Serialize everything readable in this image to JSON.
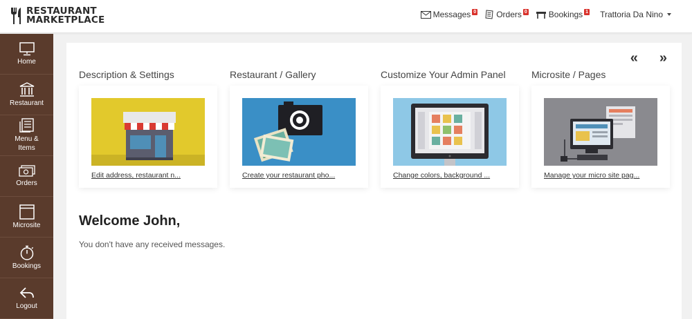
{
  "brand": {
    "line1": "RESTAURANT",
    "line2": "MARKETPLACE"
  },
  "header": {
    "messages": {
      "label": "Messages",
      "count": "0"
    },
    "orders": {
      "label": "Orders",
      "count": "0"
    },
    "bookings": {
      "label": "Bookings",
      "count": "1"
    },
    "user": "Trattoria Da Nino"
  },
  "sidebar": {
    "items": [
      {
        "label": "Home",
        "icon": "monitor-icon"
      },
      {
        "label": "Restaurant",
        "icon": "building-icon"
      },
      {
        "label": "Menu & Items",
        "icon": "menu-icon"
      },
      {
        "label": "Orders",
        "icon": "money-icon"
      },
      {
        "label": "Microsite",
        "icon": "window-icon"
      },
      {
        "label": "Bookings",
        "icon": "stopwatch-icon"
      },
      {
        "label": "Logout",
        "icon": "logout-icon"
      }
    ]
  },
  "carousel": {
    "prev": "«",
    "next": "»",
    "cards": [
      {
        "title": "Description & Settings",
        "link": "Edit address, restaurant n..."
      },
      {
        "title": "Restaurant / Gallery",
        "link": "Create your restaurant pho..."
      },
      {
        "title": "Customize Your Admin Panel",
        "link": "Change colors, background ..."
      },
      {
        "title": "Microsite / Pages",
        "link": "Manage your micro site pag..."
      }
    ]
  },
  "welcome": "Welcome John,",
  "message": "You don't have any received messages.",
  "colors": {
    "sidebar": "#5a3b2c",
    "badge": "#d9312b",
    "background": "#f1f1f1"
  }
}
